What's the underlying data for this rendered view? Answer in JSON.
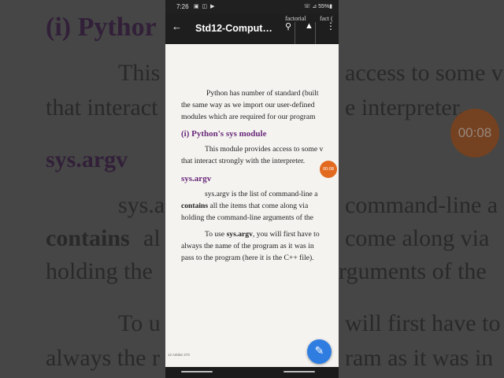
{
  "background": {
    "heading": "(i)  Pythor",
    "line1": "This",
    "line1b": "access to some v",
    "line2": "that interact",
    "line2b": "e interpreter.",
    "argv": "sys.argv",
    "line3": "sys.a",
    "line3b": "command-line a",
    "line4": "contains",
    "line4a": " al",
    "line4b": "come along via",
    "line5": "holding the",
    "line5b": "rguments of the",
    "line6": "To u",
    "line6b": "will first have to",
    "line7": "always the r",
    "line7b": "ram as it was in",
    "timer": "00:08"
  },
  "status_bar": {
    "time": "7:26",
    "icons": "▣ ◫ ▶",
    "right": "☏ ⊿ 55%▮"
  },
  "app_bar": {
    "title": "Std12-Comput…",
    "back_icon": "←",
    "search_icon": "⚲",
    "drive_icon": "▲",
    "more_icon": "⋮"
  },
  "overlay": {
    "label1": "factorial",
    "label2": "fact ("
  },
  "document": {
    "para1": [
      "Python has number of standard (built",
      "the same way as we import our user-defined",
      "modules which are required for our program"
    ],
    "heading1": "(i)  Python's sys module",
    "para2": [
      "This module provides access to some v",
      "that interact strongly with the interpreter."
    ],
    "heading2": "sys.argv",
    "para3_l1": "sys.argv is the list of command-line a",
    "para3_l2_bold": "contains",
    "para3_l2_rest": " all the items that come along via",
    "para3_l3": "holding the command-line arguments of the",
    "para4_l1_pre": "To use ",
    "para4_l1_bold": "sys.argv",
    "para4_l1_post": ", you will first have to",
    "para4_l2": "always the name of the program as it was in",
    "para4_l3": "pass to the program (here it is the C++ file).",
    "footer": "12 Adobe   273",
    "mini_timer": "00:08"
  },
  "fab_icon": "✎"
}
